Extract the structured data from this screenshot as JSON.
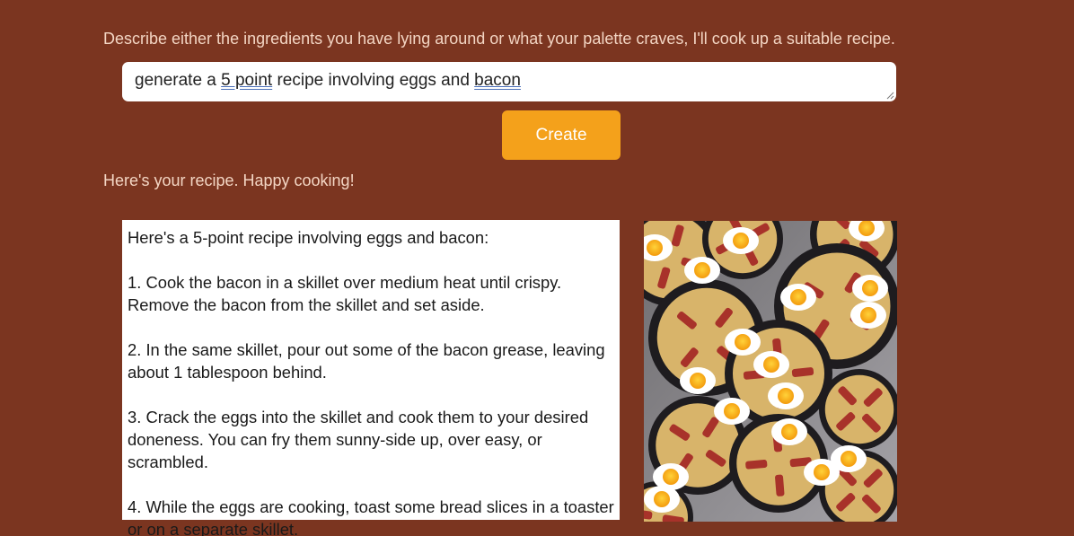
{
  "prompt": {
    "label": "Describe either the ingredients you have lying around or what your palette craves, I'll cook up a suitable recipe.",
    "input_value_parts": [
      "generate a ",
      "5 point",
      " recipe involving eggs and ",
      "bacon"
    ]
  },
  "create_button": {
    "label": "Create",
    "color": "#f4a11b"
  },
  "result": {
    "label": "Here's your recipe. Happy cooking!",
    "recipe_lines": [
      "Here's a 5-point recipe involving eggs and bacon:",
      "",
      "1. Cook the bacon in a skillet over medium heat until crispy.",
      "Remove the bacon from the skillet and set aside.",
      "",
      "2. In the same skillet, pour out some of the bacon grease, leaving",
      "about 1 tablespoon behind.",
      "",
      "3. Crack the eggs into the skillet and cook them to your desired",
      "doneness. You can fry them sunny-side up, over easy, or",
      "scrambled.",
      "",
      "4. While the eggs are cooking, toast some bread slices in a toaster",
      "or on a separate skillet."
    ]
  },
  "image": {
    "subject": "eggs-and-bacon-skillets-photo"
  },
  "colors": {
    "background": "#7b3520",
    "label_text": "#f3d5c3",
    "accent": "#f4a11b"
  }
}
